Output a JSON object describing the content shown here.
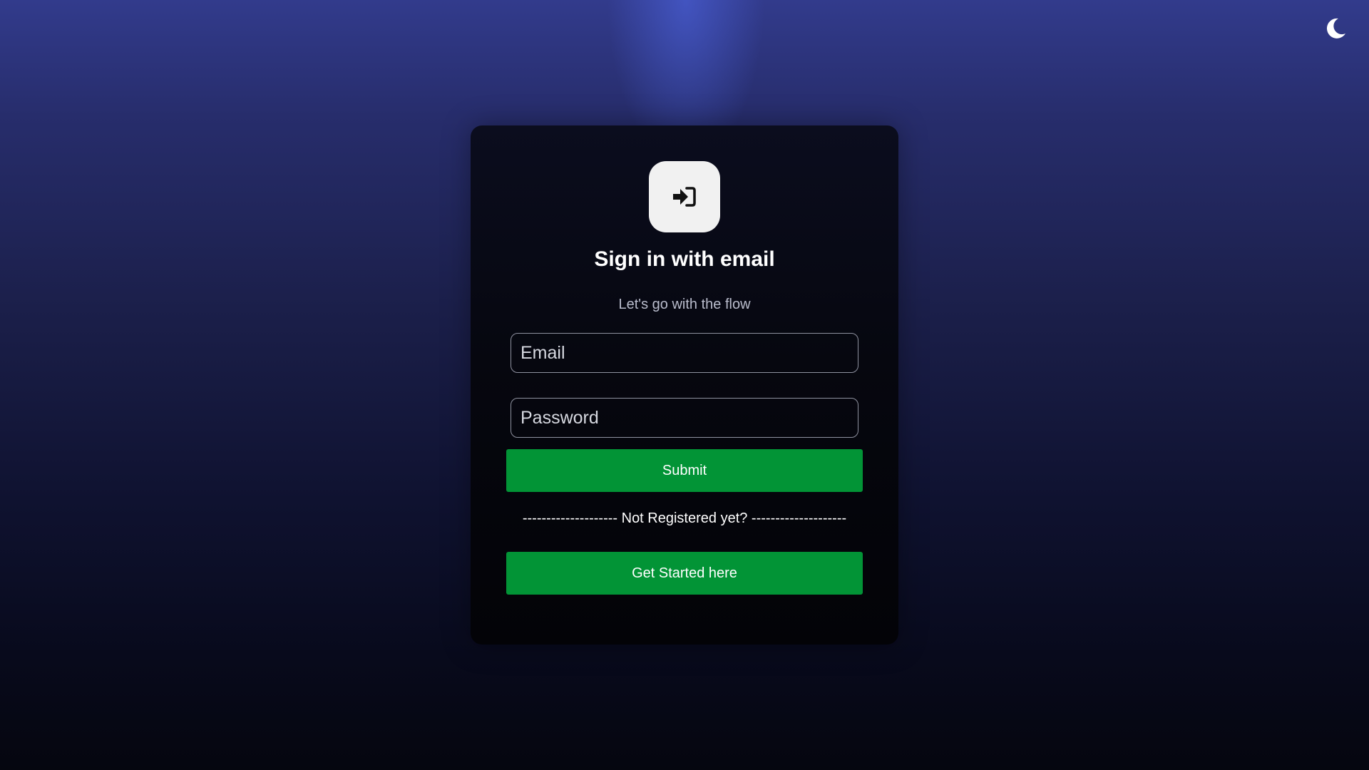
{
  "theme_toggle": {
    "icon": "moon-icon",
    "color": "#ffffff"
  },
  "card": {
    "icon": "sign-in-arrow-icon",
    "title": "Sign in with email",
    "subtitle": "Let's go with the flow"
  },
  "form": {
    "email_placeholder": "Email",
    "email_value": "",
    "password_placeholder": "Password",
    "password_value": "",
    "submit_label": "Submit"
  },
  "register": {
    "divider_text": "-------------------- Not Registered yet? --------------------",
    "button_label": "Get Started here"
  },
  "colors": {
    "accent_green": "#029436",
    "background_top": "#323b8c",
    "background_bottom": "#05060f",
    "card_background": "#06070f"
  }
}
